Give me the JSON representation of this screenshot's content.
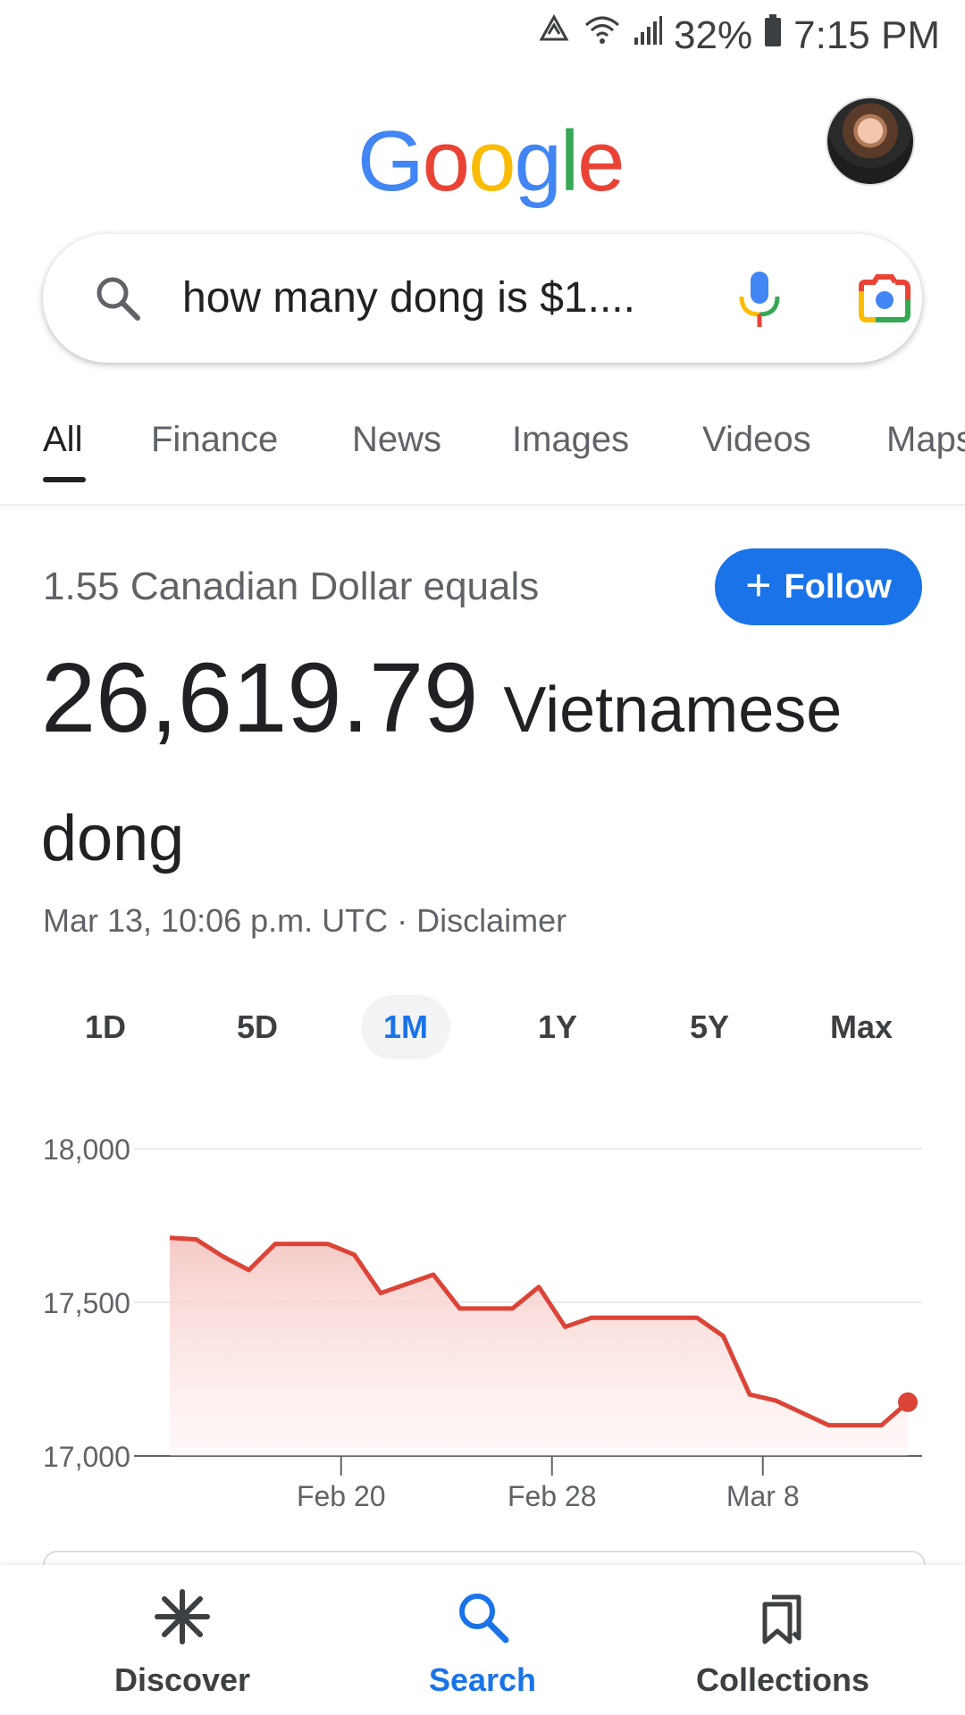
{
  "status_bar": {
    "battery": "32%",
    "time": "7:15 PM"
  },
  "header": {
    "logo_letters": [
      "G",
      "o",
      "o",
      "g",
      "l",
      "e"
    ],
    "logo_colors": [
      "#4285F4",
      "#EA4335",
      "#FBBC05",
      "#4285F4",
      "#34A853",
      "#EA4335"
    ]
  },
  "search": {
    "query": "how many dong is $1...."
  },
  "tabs": [
    {
      "label": "All",
      "active": true
    },
    {
      "label": "Finance"
    },
    {
      "label": "News"
    },
    {
      "label": "Images"
    },
    {
      "label": "Videos"
    },
    {
      "label": "Maps"
    }
  ],
  "result": {
    "equals_text": "1.55 Canadian Dollar equals",
    "follow_label": "Follow",
    "value": "26,619.79",
    "unit_line1": "Vietnamese",
    "unit_line2": "dong",
    "timestamp": "Mar 13, 10:06 p.m. UTC · Disclaimer"
  },
  "ranges": [
    {
      "label": "1D"
    },
    {
      "label": "5D"
    },
    {
      "label": "1M",
      "active": true
    },
    {
      "label": "1Y"
    },
    {
      "label": "5Y"
    },
    {
      "label": "Max"
    }
  ],
  "chart_data": {
    "type": "area",
    "ylim": [
      17000,
      18000
    ],
    "yticks": [
      "18,000",
      "17,500",
      "17,000"
    ],
    "ytick_values": [
      18000,
      17500,
      17000
    ],
    "xticks": [
      "Feb 20",
      "Feb 28",
      "Mar 8"
    ],
    "xtick_index": [
      6.5,
      14.5,
      22.5
    ],
    "values": [
      17710,
      17705,
      17650,
      17605,
      17690,
      17690,
      17690,
      17655,
      17530,
      17560,
      17590,
      17480,
      17480,
      17480,
      17550,
      17420,
      17450,
      17450,
      17450,
      17450,
      17450,
      17390,
      17200,
      17180,
      17140,
      17100,
      17100,
      17100,
      17175
    ],
    "line_color": "#db4437"
  },
  "bottom_nav": [
    {
      "label": "Discover",
      "icon": "asterisk-icon"
    },
    {
      "label": "Search",
      "icon": "search-icon",
      "active": true
    },
    {
      "label": "Collections",
      "icon": "bookmarks-icon"
    }
  ]
}
